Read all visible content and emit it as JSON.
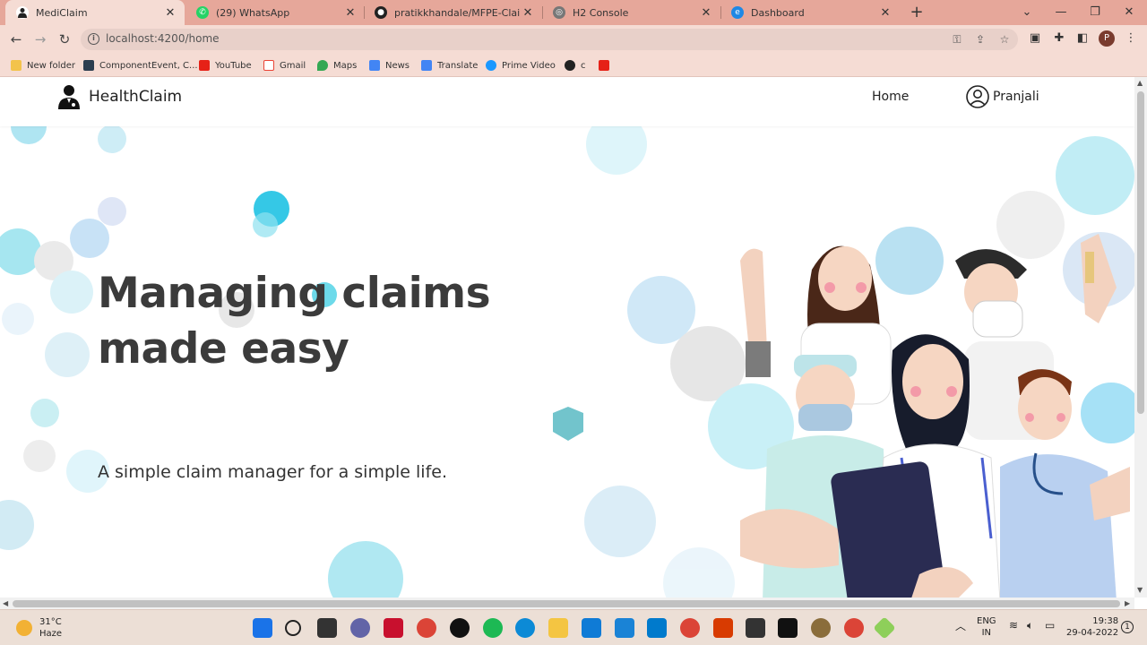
{
  "browser": {
    "tabs": [
      {
        "label": "MediClaim",
        "active": true
      },
      {
        "label": "(29) WhatsApp",
        "active": false
      },
      {
        "label": "pratikkhandale/MFPE-Claim-Man",
        "active": false
      },
      {
        "label": "H2 Console",
        "active": false
      },
      {
        "label": "Dashboard",
        "active": false
      }
    ],
    "url": "localhost:4200/home",
    "bookmarks": [
      {
        "label": "New folder",
        "icon": "folder-icon"
      },
      {
        "label": "ComponentEvent, C...",
        "icon": "bookmark-site-icon"
      },
      {
        "label": "YouTube",
        "icon": "youtube-icon"
      },
      {
        "label": "Gmail",
        "icon": "gmail-icon"
      },
      {
        "label": "Maps",
        "icon": "maps-icon"
      },
      {
        "label": "News",
        "icon": "news-icon"
      },
      {
        "label": "Translate",
        "icon": "translate-icon"
      },
      {
        "label": "Prime Video",
        "icon": "prime-video-icon"
      },
      {
        "label": "c",
        "icon": "github-icon"
      },
      {
        "label": "",
        "icon": "youtube-icon"
      }
    ],
    "profile_initial": "P"
  },
  "app": {
    "brand": "HealthClaim",
    "nav": {
      "home": "Home",
      "user": "Pranjali"
    },
    "hero": {
      "title_line1": "Managing claims",
      "title_line2": "made easy",
      "subtitle": "A simple claim manager for a simple life."
    }
  },
  "taskbar": {
    "weather": {
      "temp": "31°C",
      "condition": "Haze"
    },
    "lang": {
      "line1": "ENG",
      "line2": "IN"
    },
    "time": "19:38",
    "date": "29-04-2022",
    "notifications": "1"
  }
}
